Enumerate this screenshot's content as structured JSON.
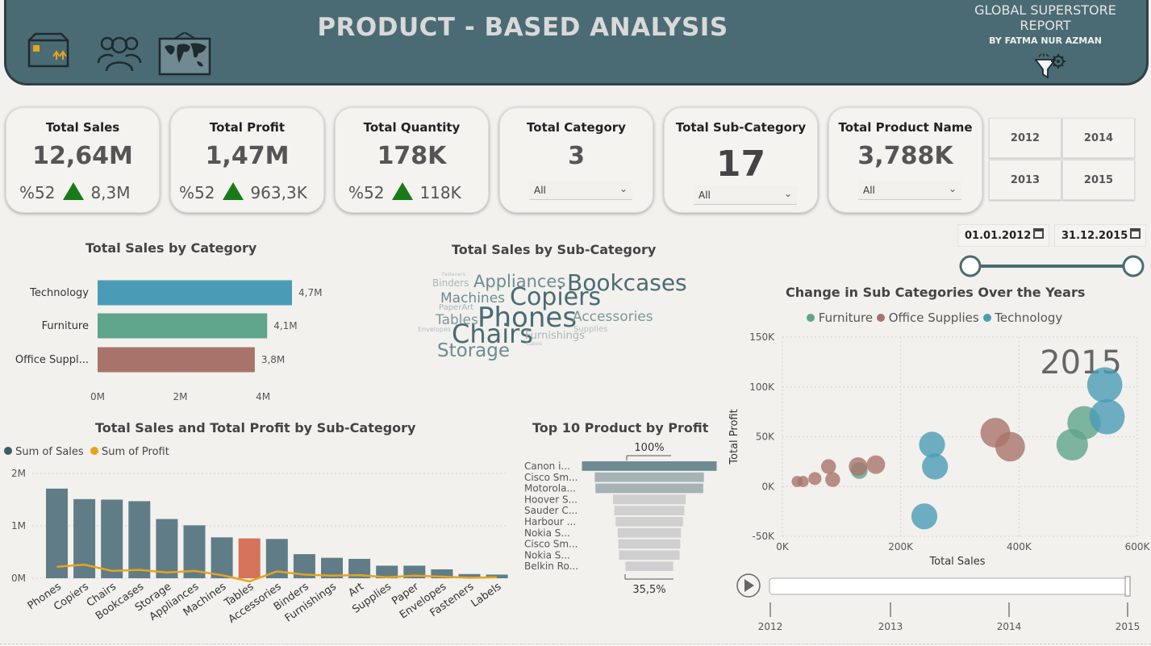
{
  "header": {
    "title": "PRODUCT - BASED ANALYSIS",
    "report_title": "GLOBAL SUPERSTORE REPORT",
    "author": "BY FATMA NUR AZMAN",
    "nav_icons": [
      "product-box-icon",
      "customers-icon",
      "world-map-icon"
    ],
    "filter_icon": "filter-gear-icon"
  },
  "kpis": {
    "sales": {
      "label": "Total Sales",
      "value": "12,64M",
      "pct": "%52",
      "sub": "8,3M"
    },
    "profit": {
      "label": "Total Profit",
      "value": "1,47M",
      "pct": "%52",
      "sub": "963,3K"
    },
    "quantity": {
      "label": "Total Quantity",
      "value": "178K",
      "pct": "%52",
      "sub": "118K"
    },
    "category": {
      "label": "Total Category",
      "value": "3",
      "slicer": "All"
    },
    "subcategory": {
      "label": "Total Sub-Category",
      "value": "17",
      "slicer": "All"
    },
    "product": {
      "label": "Total Product Name",
      "value": "3,788K",
      "slicer": "All"
    }
  },
  "years": [
    "2012",
    "2014",
    "2013",
    "2015"
  ],
  "date_range": {
    "start": "01.01.2012",
    "end": "31.12.2015"
  },
  "colors": {
    "header": "#4a6b73",
    "tech": "#4a9cb6",
    "furniture": "#5fa58b",
    "office": "#a8746a",
    "bar": "#607d87",
    "profit_line": "#e8a31e",
    "highlight": "#d4735a",
    "up": "#1a7a1a"
  },
  "chart_data": [
    {
      "id": "sales_by_category",
      "type": "bar",
      "title": "Total Sales by Category",
      "categories": [
        "Technology",
        "Furniture",
        "Office Suppl..."
      ],
      "values": [
        4.7,
        4.1,
        3.8
      ],
      "data_labels": [
        "4,7M",
        "4,1M",
        "3,8M"
      ],
      "xticks": [
        "0M",
        "2M",
        "4M"
      ],
      "xlim": [
        0,
        4.7
      ]
    },
    {
      "id": "sales_by_subcategory_wordcloud",
      "type": "table",
      "title": "Total Sales by Sub-Category",
      "words": [
        "Bookcases",
        "Phones",
        "Copiers",
        "Chairs",
        "Appliances",
        "Storage",
        "Machines",
        "Accessories",
        "Tables",
        "Binders",
        "Furnishings",
        "PaperArt",
        "Envelopes",
        "Supplies",
        "Fasteners",
        "Labels"
      ]
    },
    {
      "id": "sales_profit_by_subcategory",
      "type": "bar",
      "title": "Total Sales and Total Profit by Sub-Category",
      "legend": [
        "Sum of Sales",
        "Sum of Profit"
      ],
      "categories": [
        "Phones",
        "Copiers",
        "Chairs",
        "Bookcases",
        "Storage",
        "Appliances",
        "Machines",
        "Tables",
        "Accessories",
        "Binders",
        "Furnishings",
        "Art",
        "Supplies",
        "Paper",
        "Envelopes",
        "Fasteners",
        "Labels"
      ],
      "series": [
        {
          "name": "Sum of Sales",
          "values": [
            1.71,
            1.51,
            1.5,
            1.47,
            1.13,
            1.01,
            0.78,
            0.76,
            0.75,
            0.46,
            0.39,
            0.37,
            0.24,
            0.24,
            0.17,
            0.08,
            0.07
          ]
        },
        {
          "name": "Sum of Profit",
          "values": [
            0.22,
            0.26,
            0.14,
            0.16,
            0.11,
            0.14,
            0.06,
            -0.06,
            0.13,
            0.07,
            0.05,
            0.06,
            0.02,
            0.05,
            0.03,
            0.01,
            0.02
          ]
        }
      ],
      "highlight_index": 7,
      "yticks": [
        "0M",
        "1M",
        "2M"
      ],
      "ylim": [
        0,
        2
      ]
    },
    {
      "id": "top10_products_profit",
      "type": "bar",
      "title": "Top 10 Product by Profit",
      "categories": [
        "Canon i...",
        "Cisco Sm...",
        "Motorola...",
        "Hoover S...",
        "Sauder C...",
        "Harbour ...",
        "Nokia S...",
        "Cisco Sm...",
        "Nokia S...",
        "Belkin Ro..."
      ],
      "values": [
        100,
        81,
        80,
        54,
        52,
        50,
        47,
        46,
        45,
        35.5
      ],
      "top_label": "100%",
      "bottom_label": "35,5%"
    },
    {
      "id": "subcategories_over_years",
      "type": "scatter",
      "title": "Change in Sub Categories Over the Years",
      "year_label": "2015",
      "legend": [
        "Furniture",
        "Office Supplies",
        "Technology"
      ],
      "xlabel": "Total Sales",
      "ylabel": "Total Profit",
      "xticks": [
        "0K",
        "200K",
        "400K",
        "600K"
      ],
      "yticks": [
        "-50K",
        "0K",
        "50K",
        "100K",
        "150K"
      ],
      "xlim": [
        0,
        600
      ],
      "ylim": [
        -50,
        150
      ],
      "series": [
        {
          "name": "Furniture",
          "points": [
            [
              130,
              16,
              9
            ],
            [
              490,
              42,
              17
            ],
            [
              510,
              64,
              18
            ]
          ]
        },
        {
          "name": "Office Supplies",
          "points": [
            [
              25,
              5,
              6
            ],
            [
              35,
              5,
              6
            ],
            [
              55,
              8,
              7
            ],
            [
              78,
              20,
              8
            ],
            [
              85,
              7,
              8
            ],
            [
              128,
              20,
              10
            ],
            [
              158,
              22,
              10
            ],
            [
              360,
              54,
              16
            ],
            [
              385,
              40,
              16
            ]
          ]
        },
        {
          "name": "Technology",
          "points": [
            [
              240,
              -30,
              14
            ],
            [
              253,
              42,
              14
            ],
            [
              258,
              20,
              14
            ],
            [
              545,
              102,
              19
            ],
            [
              549,
              70,
              19
            ]
          ]
        }
      ],
      "play_axis_ticks": [
        "2012",
        "2013",
        "2014",
        "2015"
      ]
    }
  ]
}
